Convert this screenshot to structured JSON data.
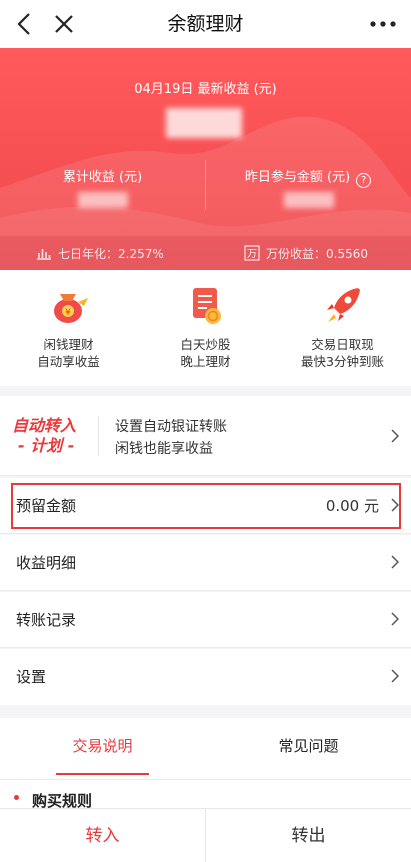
{
  "nav": {
    "title": "余额理财"
  },
  "hero": {
    "date_line": "04月19日 最新收益 (元)",
    "cumulative_label": "累计收益 (元)",
    "yesterday_label": "昨日参与金额 (元)",
    "seven_day_label": "七日年化：2.257%",
    "per_ten_k_label": "万份收益：0.5560",
    "wan_badge": "万"
  },
  "features": [
    {
      "line1": "闲钱理财",
      "line2": "自动享收益",
      "icon": "money-bag-icon"
    },
    {
      "line1": "白天炒股",
      "line2": "晚上理财",
      "icon": "document-coin-icon"
    },
    {
      "line1": "交易日取现",
      "line2": "最快3分钟到账",
      "icon": "rocket-icon"
    }
  ],
  "plan": {
    "logo_line1": "自动转入",
    "logo_line2": "- 计划 -",
    "line1": "设置自动银证转账",
    "line2": "闲钱也能享收益"
  },
  "rows": {
    "reserve": {
      "label": "预留金额",
      "value": "0.00 元"
    },
    "income": {
      "label": "收益明细"
    },
    "transfer": {
      "label": "转账记录"
    },
    "settings": {
      "label": "设置"
    }
  },
  "tabs": {
    "trade": "交易说明",
    "faq": "常见问题"
  },
  "section": {
    "buy_rules": "购买规则"
  },
  "bottom": {
    "transfer_in": "转入",
    "transfer_out": "转出"
  },
  "colors": {
    "accent": "#e83a3c",
    "hero_bg": "#f0474c"
  }
}
